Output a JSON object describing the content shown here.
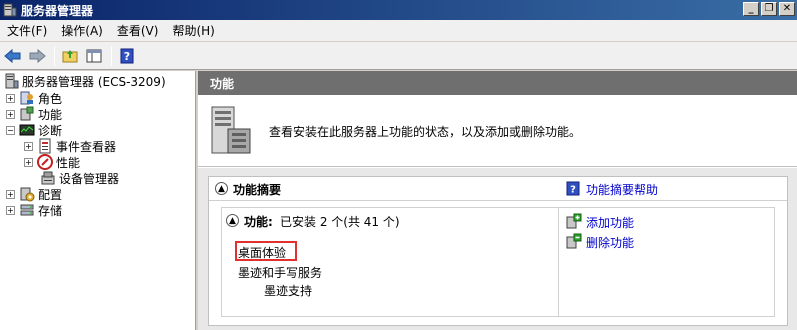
{
  "window": {
    "title": "服务器管理器",
    "buttons": {
      "minimize": "_",
      "restore": "❐",
      "close": "✕"
    }
  },
  "menubar": {
    "items": [
      "文件(F)",
      "操作(A)",
      "查看(V)",
      "帮助(H)"
    ]
  },
  "toolbar": {
    "icons": [
      "back-arrow-icon",
      "forward-arrow-icon",
      "up-folder-icon",
      "show-hide-tree-icon",
      "help-icon"
    ]
  },
  "tree": {
    "root": "服务器管理器 (ECS-3209)",
    "items": [
      {
        "label": "角色",
        "expander": "+"
      },
      {
        "label": "功能",
        "expander": "+"
      },
      {
        "label": "诊断",
        "expander": "−"
      },
      {
        "label": "事件查看器",
        "expander": "+"
      },
      {
        "label": "性能",
        "expander": "+"
      },
      {
        "label": "设备管理器",
        "expander": ""
      },
      {
        "label": "配置",
        "expander": "+"
      },
      {
        "label": "存储",
        "expander": "+"
      }
    ]
  },
  "right": {
    "header": "功能",
    "description": "查看安装在此服务器上功能的状态，以及添加或删除功能。",
    "section": {
      "title": "功能摘要",
      "help_link": "功能摘要帮助",
      "summary_label": "功能:",
      "summary_value": "已安装 2 个(共 41 个)",
      "features": [
        "桌面体验",
        "墨迹和手写服务",
        "墨迹支持"
      ],
      "actions": [
        "添加功能",
        "删除功能"
      ]
    }
  },
  "colors": {
    "titlebar": "#0a246a",
    "header_bar": "#6f6f6f",
    "link": "#0000cc",
    "highlight": "#e03030"
  }
}
